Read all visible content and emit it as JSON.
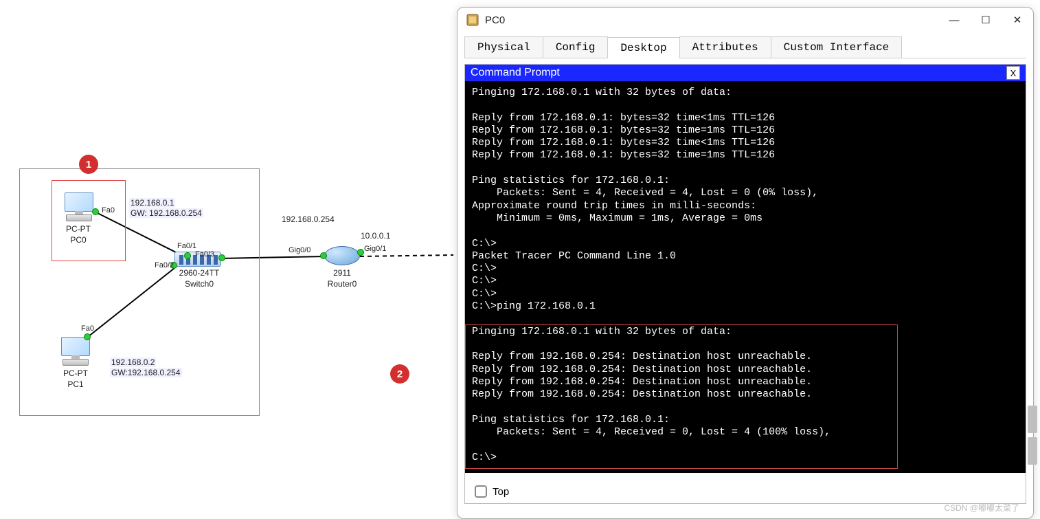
{
  "topology": {
    "callout1": "1",
    "callout2": "2",
    "pc0": {
      "type": "PC-PT",
      "name": "PC0",
      "iface": "Fa0",
      "ip": "192.168.0.1",
      "gw": "GW: 192.168.0.254"
    },
    "pc1": {
      "type": "PC-PT",
      "name": "PC1",
      "iface": "Fa0",
      "ip": "192.168.0.2",
      "gw": "GW:192.168.0.254"
    },
    "switch": {
      "model": "2960-24TT",
      "name": "Switch0",
      "if1": "Fa0/1",
      "if2": "Fa0/2",
      "if3": "Fa0/3"
    },
    "router": {
      "model": "2911",
      "name": "Router0",
      "ifL": "Gig0/0",
      "ifR": "Gig0/1",
      "ipL": "192.168.0.254",
      "ipR": "10.0.0.1"
    }
  },
  "window": {
    "title": "PC0",
    "tabs": {
      "physical": "Physical",
      "config": "Config",
      "desktop": "Desktop",
      "attributes": "Attributes",
      "custom": "Custom Interface"
    },
    "cmd_title": "Command Prompt",
    "cmd_close": "X",
    "top_label": "Top"
  },
  "terminal": {
    "body": "Pinging 172.168.0.1 with 32 bytes of data:\n\nReply from 172.168.0.1: bytes=32 time<1ms TTL=126\nReply from 172.168.0.1: bytes=32 time=1ms TTL=126\nReply from 172.168.0.1: bytes=32 time<1ms TTL=126\nReply from 172.168.0.1: bytes=32 time=1ms TTL=126\n\nPing statistics for 172.168.0.1:\n    Packets: Sent = 4, Received = 4, Lost = 0 (0% loss),\nApproximate round trip times in milli-seconds:\n    Minimum = 0ms, Maximum = 1ms, Average = 0ms\n\nC:\\>\nPacket Tracer PC Command Line 1.0\nC:\\>\nC:\\>\nC:\\>\nC:\\>ping 172.168.0.1\n\nPinging 172.168.0.1 with 32 bytes of data:\n\nReply from 192.168.0.254: Destination host unreachable.\nReply from 192.168.0.254: Destination host unreachable.\nReply from 192.168.0.254: Destination host unreachable.\nReply from 192.168.0.254: Destination host unreachable.\n\nPing statistics for 172.168.0.1:\n    Packets: Sent = 4, Received = 0, Lost = 4 (100% loss),\n\nC:\\>"
  },
  "watermark": "CSDN @嘟嘟太菜了"
}
